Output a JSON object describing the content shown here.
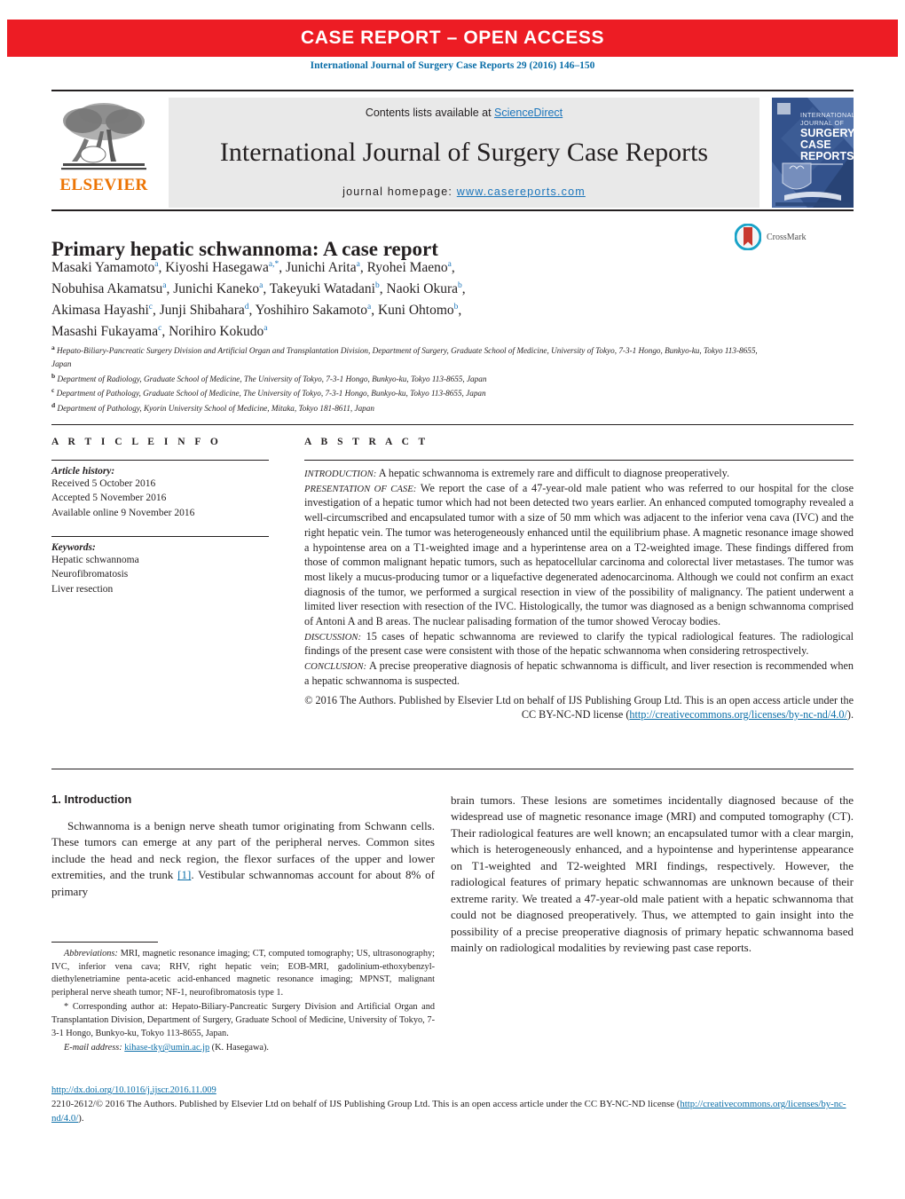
{
  "banner": {
    "text": "CASE REPORT – OPEN ACCESS",
    "color": "#ed1c24"
  },
  "citation": "International Journal of Surgery Case Reports 29 (2016) 146–150",
  "masthead": {
    "publisher_logo_word": "ELSEVIER",
    "contents_prefix": "Contents lists available at ",
    "contents_link": "ScienceDirect",
    "journal_name": "International Journal of Surgery Case Reports",
    "homepage_prefix": "journal homepage: ",
    "homepage_url": "www.casereports.com",
    "cover": {
      "line1": "INTERNATIONAL",
      "line2": "JOURNAL OF",
      "line3": "SURGERY",
      "line4": "CASE",
      "line5": "REPORTS"
    }
  },
  "article": {
    "title": "Primary hepatic schwannoma: A case report",
    "crossmark_label": "CrossMark",
    "authors_lines": [
      "Masaki Yamamoto a, Kiyoshi Hasegawa a,*, Junichi Arita a, Ryohei Maeno a,",
      "Nobuhisa Akamatsu a, Junichi Kaneko a, Takeyuki Watadani b, Naoki Okura b,",
      "Akimasa Hayashi c, Junji Shibahara d, Yoshihiro Sakamoto a, Kuni Ohtomo b,",
      "Masashi Fukayama c, Norihiro Kokudo a"
    ],
    "affiliations": [
      {
        "mark": "a",
        "text": "Hepato-Biliary-Pancreatic Surgery Division and Artificial Organ and Transplantation Division, Department of Surgery, Graduate School of Medicine, University of Tokyo, 7-3-1 Hongo, Bunkyo-ku, Tokyo 113-8655, Japan"
      },
      {
        "mark": "b",
        "text": "Department of Radiology, Graduate School of Medicine, The University of Tokyo, 7-3-1 Hongo, Bunkyo-ku, Tokyo 113-8655, Japan"
      },
      {
        "mark": "c",
        "text": "Department of Pathology, Graduate School of Medicine, The University of Tokyo, 7-3-1 Hongo, Bunkyo-ku, Tokyo 113-8655, Japan"
      },
      {
        "mark": "d",
        "text": "Department of Pathology, Kyorin University School of Medicine, Mitaka, Tokyo 181-8611, Japan"
      }
    ]
  },
  "article_info": {
    "heading": "A R T I C L E   I N F O",
    "history_label": "Article history:",
    "history": [
      "Received 5 October 2016",
      "Accepted 5 November 2016",
      "Available online 9 November 2016"
    ],
    "keywords_label": "Keywords:",
    "keywords": [
      "Hepatic schwannoma",
      "Neurofibromatosis",
      "Liver resection"
    ]
  },
  "abstract": {
    "heading": "A B S T R A C T",
    "paragraphs": [
      {
        "tag": "INTRODUCTION:",
        "text": " A hepatic schwannoma is extremely rare and difficult to diagnose preoperatively."
      },
      {
        "tag": "PRESENTATION OF CASE:",
        "text": " We report the case of a 47-year-old male patient who was referred to our hospital for the close investigation of a hepatic tumor which had not been detected two years earlier. An enhanced computed tomography revealed a well-circumscribed and encapsulated tumor with a size of 50 mm which was adjacent to the inferior vena cava (IVC) and the right hepatic vein. The tumor was heterogeneously enhanced until the equilibrium phase. A magnetic resonance image showed a hypointense area on a T1-weighted image and a hyperintense area on a T2-weighted image. These findings differed from those of common malignant hepatic tumors, such as hepatocellular carcinoma and colorectal liver metastases. The tumor was most likely a mucus-producing tumor or a liquefactive degenerated adenocarcinoma. Although we could not confirm an exact diagnosis of the tumor, we performed a surgical resection in view of the possibility of malignancy. The patient underwent a limited liver resection with resection of the IVC. Histologically, the tumor was diagnosed as a benign schwannoma comprised of Antoni A and B areas. The nuclear palisading formation of the tumor showed Verocay bodies."
      },
      {
        "tag": "DISCUSSION:",
        "text": " 15 cases of hepatic schwannoma are reviewed to clarify the typical radiological features. The radiological findings of the present case were consistent with those of the hepatic schwannoma when considering retrospectively."
      },
      {
        "tag": "CONCLUSION:",
        "text": " A precise preoperative diagnosis of hepatic schwannoma is difficult, and liver resection is recommended when a hepatic schwannoma is suspected."
      }
    ],
    "copyright_prefix": "© 2016 The Authors. Published by Elsevier Ltd on behalf of IJS Publishing Group Ltd. This is an open access article under the CC BY-NC-ND license (",
    "copyright_link": "http://creativecommons.org/licenses/by-nc-nd/4.0/",
    "copyright_suffix": ")."
  },
  "body": {
    "section_heading": "1.  Introduction",
    "left_paragraph_pre": "Schwannoma is a benign nerve sheath tumor originating from Schwann cells. These tumors can emerge at any part of the peripheral nerves. Common sites include the head and neck region, the flexor surfaces of the upper and lower extremities, and the trunk ",
    "left_citation": "[1]",
    "left_paragraph_post": ". Vestibular schwannomas account for about 8% of primary",
    "right_paragraph": "brain tumors. These lesions are sometimes incidentally diagnosed because of the widespread use of magnetic resonance image (MRI) and computed tomography (CT). Their radiological features are well known; an encapsulated tumor with a clear margin, which is heterogeneously enhanced, and a hypointense and hyperintense appearance on T1-weighted and T2-weighted MRI findings, respectively. However, the radiological features of primary hepatic schwannomas are unknown because of their extreme rarity. We treated a 47-year-old male patient with a hepatic schwannoma that could not be diagnosed preoperatively. Thus, we attempted to gain insight into the possibility of a precise preoperative diagnosis of primary hepatic schwannoma based mainly on radiological modalities by reviewing past case reports."
  },
  "footnotes": {
    "abbrev_label": "Abbreviations:",
    "abbrev_text": " MRI, magnetic resonance imaging; CT, computed tomography; US, ultrasonography; IVC, inferior vena cava; RHV, right hepatic vein; EOB-MRI, gadolinium-ethoxybenzyl-diethylenetriamine penta-acetic acid-enhanced magnetic resonance imaging; MPNST, malignant peripheral nerve sheath tumor; NF-1, neurofibromatosis type 1.",
    "corresponding_marker": "*",
    "corresponding_text": " Corresponding author at: Hepato-Biliary-Pancreatic Surgery Division and Artificial Organ and Transplantation Division, Department of Surgery, Graduate School of Medicine, University of Tokyo, 7-3-1 Hongo, Bunkyo-ku, Tokyo 113-8655, Japan.",
    "email_label": "E-mail address:",
    "email_link": "kihase-tky@umin.ac.jp",
    "email_suffix": " (K. Hasegawa)."
  },
  "footer": {
    "doi": "http://dx.doi.org/10.1016/j.ijscr.2016.11.009",
    "issn_line_prefix": "2210-2612/© 2016 The Authors. Published by Elsevier Ltd on behalf of IJS Publishing Group Ltd. This is an open access article under the CC BY-NC-ND license (",
    "issn_link": "http://creativecommons.org/licenses/by-nc-nd/4.0/",
    "issn_line_suffix": ")."
  },
  "colors": {
    "banner_red": "#ed1c24",
    "link_blue": "#0a6ea8",
    "elsevier_orange": "#ec7404",
    "band_gray": "#e9e9e9"
  }
}
